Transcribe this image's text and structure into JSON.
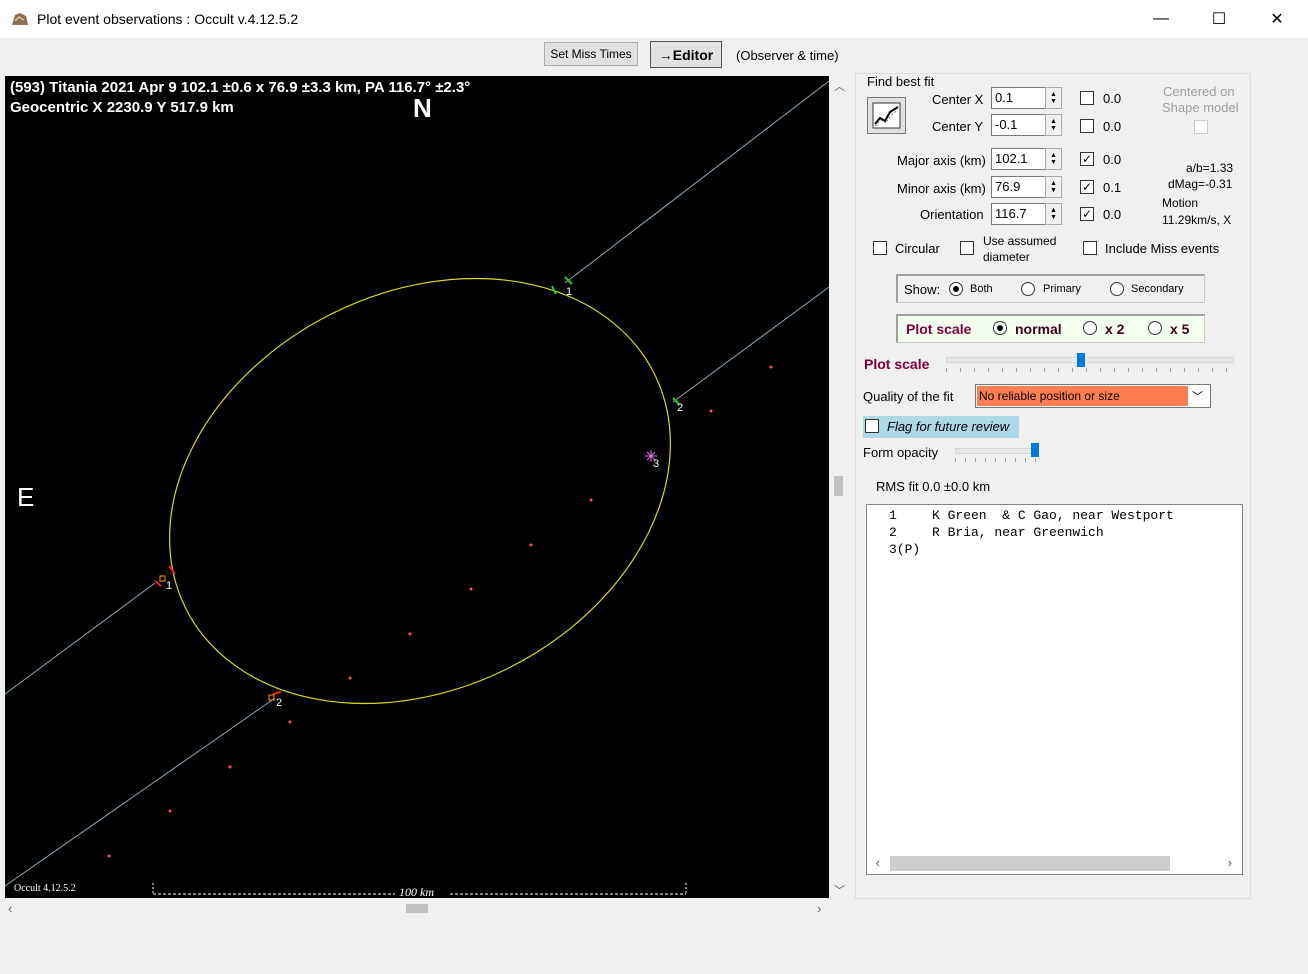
{
  "window": {
    "title": "Plot event observations : Occult v.4.12.5.2",
    "minimize": "—",
    "maximize": "☐",
    "close": "✕"
  },
  "toolbar": {
    "set_miss_times": "Set Miss Times",
    "editor": "→Editor",
    "observer_time": "(Observer & time)"
  },
  "plot": {
    "header_line1": "(593) Titania  2021 Apr 9   102.1 ±0.6 x 76.9 ±3.3 km, PA 116.7° ±2.3°",
    "header_line2": "Geocentric  X  2230.9  Y 517.9 km",
    "north": "N",
    "east": "E",
    "footer": "Occult 4.12.5.2",
    "scale_label": "100 km",
    "chord_labels": [
      "1",
      "2",
      "1",
      "2",
      "3"
    ]
  },
  "fit": {
    "title": "Find best fit",
    "center_x_label": "Center X",
    "center_x": "0.1",
    "center_x_check": "0.0",
    "center_y_label": "Center Y",
    "center_y": "-0.1",
    "center_y_check": "0.0",
    "major_label": "Major axis (km)",
    "major": "102.1",
    "major_check": "0.0",
    "minor_label": "Minor axis (km)",
    "minor": "76.9",
    "minor_check": "0.1",
    "orient_label": "Orientation",
    "orient": "116.7",
    "orient_check": "0.0",
    "centered_on": "Centered on",
    "shape_model": "Shape model",
    "ab": "a/b=1.33",
    "dmag": "dMag=-0.31",
    "motion": "Motion",
    "motion_val": "11.29km/s, X"
  },
  "options": {
    "circular": "Circular",
    "use_assumed_1": "Use assumed",
    "use_assumed_2": "diameter",
    "include_miss": "Include Miss events"
  },
  "show": {
    "label": "Show:",
    "both": "Both",
    "primary": "Primary",
    "secondary": "Secondary"
  },
  "plot_scale": {
    "label": "Plot scale",
    "normal": "normal",
    "x2": "x 2",
    "x5": "x 5",
    "slider_label": "Plot scale",
    "slider_value": 0.5
  },
  "quality": {
    "label": "Quality of the fit",
    "value": "No reliable position or size"
  },
  "flag": "Flag for future review",
  "opacity": {
    "label": "Form opacity",
    "value": 1.0
  },
  "rms": "RMS fit  0.0 ±0.0 km",
  "observers": [
    {
      "num": "1",
      "text": "K Green  & C Gao, near Westport"
    },
    {
      "num": "2",
      "text": "R Bria, near Greenwich"
    },
    {
      "num": "3(P)",
      "text": ""
    }
  ],
  "colors": {
    "ellipse": "#d8d820",
    "chord": "#8ca8b8",
    "quality_bg": "#ff7f50",
    "plot_scale_text": "#800040",
    "flag_bg": "#add8e6"
  }
}
